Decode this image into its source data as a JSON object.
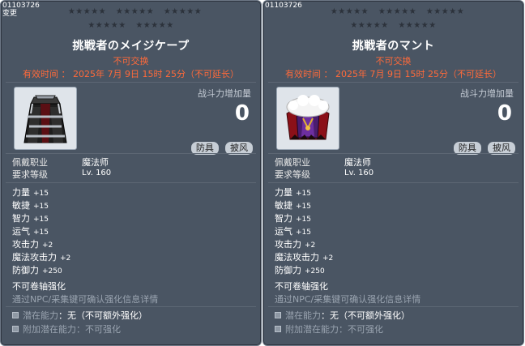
{
  "tooltips": [
    {
      "item_id": "01103726",
      "sub_label": "变更",
      "stars_row1": [
        "★★★★★",
        "★★★★★",
        "★★★★★"
      ],
      "stars_row2": [
        "★★★★★",
        "★★★★★"
      ],
      "name": "挑戦者のメイジケープ",
      "trade_status": "不可交换",
      "expiry": "有效时间 ： 2025年 7月 9日 15时 25分（不可延长）",
      "power_label": "战斗力增加量",
      "power_value": "0",
      "tags": [
        "防具",
        "披风"
      ],
      "job_label": "佩戴职业",
      "job_value": "魔法师",
      "level_label": "要求等级",
      "level_value": "Lv. 160",
      "stats": [
        {
          "name": "力量",
          "value": "+15"
        },
        {
          "name": "敏捷",
          "value": "+15"
        },
        {
          "name": "智力",
          "value": "+15"
        },
        {
          "name": "运气",
          "value": "+15"
        },
        {
          "name": "攻击力",
          "value": "+2"
        },
        {
          "name": "魔法攻击力",
          "value": "+2"
        },
        {
          "name": "防御力",
          "value": "+250"
        }
      ],
      "enhance_title": "不可卷轴强化",
      "enhance_desc": "通过NPC/采集键可确认强化信息详情",
      "potential_label": "潜在能力",
      "potential_value": "：无（不可额外强化）",
      "addl_potential_label": "附加潜在能力",
      "addl_potential_value": "：不可强化",
      "icon": "mage-cape-icon"
    },
    {
      "item_id": "01103726",
      "stars_row1": [
        "★★★★★",
        "★★★★★",
        "★★★★★"
      ],
      "stars_row2": [
        "★★★★★",
        "★★★★★"
      ],
      "name": "挑戦者のマント",
      "trade_status": "不可交换",
      "expiry": "有效时间 ： 2025年 7月 9日 15时 25分（不可延长）",
      "power_label": "战斗力增加量",
      "power_value": "0",
      "tags": [
        "防具",
        "披风"
      ],
      "job_label": "佩戴职业",
      "job_value": "魔法师",
      "level_label": "要求等级",
      "level_value": "Lv. 160",
      "stats": [
        {
          "name": "力量",
          "value": "+15"
        },
        {
          "name": "敏捷",
          "value": "+15"
        },
        {
          "name": "智力",
          "value": "+15"
        },
        {
          "name": "运气",
          "value": "+15"
        },
        {
          "name": "攻击力",
          "value": "+2"
        },
        {
          "name": "魔法攻击力",
          "value": "+2"
        },
        {
          "name": "防御力",
          "value": "+250"
        }
      ],
      "enhance_title": "不可卷轴强化",
      "enhance_desc": "通过NPC/采集键可确认强化信息详情",
      "potential_label": "潜在能力",
      "potential_value": "：无（不可额外强化）",
      "addl_potential_label": "附加潜在能力",
      "addl_potential_value": "：不可强化",
      "icon": "mantle-icon"
    }
  ],
  "colors": {
    "panel_bg": "#4a5563",
    "warning_red": "#ff6a3a",
    "dim_text": "#9aa4b0"
  }
}
